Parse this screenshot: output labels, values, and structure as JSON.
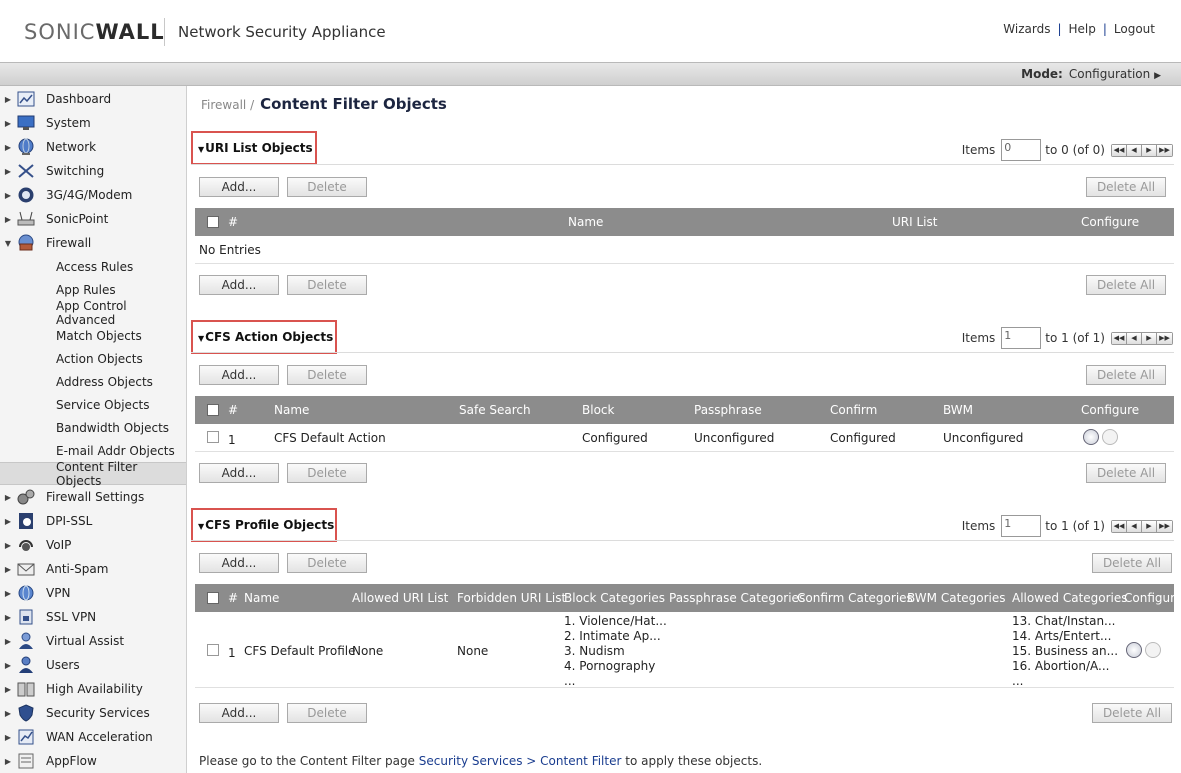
{
  "header": {
    "logo_light": "SONIC",
    "logo_bold": "WALL",
    "product": "Network Security Appliance",
    "links": [
      "Wizards",
      "Help",
      "Logout"
    ]
  },
  "modebar": {
    "label": "Mode:",
    "value": "Configuration"
  },
  "sidebar": {
    "items": [
      {
        "label": "Dashboard",
        "icon": "dashboard-icon",
        "expanded": false
      },
      {
        "label": "System",
        "icon": "monitor-icon",
        "expanded": false
      },
      {
        "label": "Network",
        "icon": "globe-icon",
        "expanded": false
      },
      {
        "label": "Switching",
        "icon": "switch-icon",
        "expanded": false
      },
      {
        "label": "3G/4G/Modem",
        "icon": "modem-icon",
        "expanded": false
      },
      {
        "label": "SonicPoint",
        "icon": "access-point-icon",
        "expanded": false
      },
      {
        "label": "Firewall",
        "icon": "firewall-icon",
        "expanded": true
      }
    ],
    "firewall_sub": [
      "Access Rules",
      "App Rules",
      "App Control Advanced",
      "Match Objects",
      "Action Objects",
      "Address Objects",
      "Service Objects",
      "Bandwidth Objects",
      "E-mail Addr Objects",
      "Content Filter Objects"
    ],
    "items_after": [
      {
        "label": "Firewall Settings",
        "icon": "gears-icon"
      },
      {
        "label": "DPI-SSL",
        "icon": "lock-icon"
      },
      {
        "label": "VoIP",
        "icon": "headset-icon"
      },
      {
        "label": "Anti-Spam",
        "icon": "mail-icon"
      },
      {
        "label": "VPN",
        "icon": "vpn-globe-icon"
      },
      {
        "label": "SSL VPN",
        "icon": "ssl-vpn-icon"
      },
      {
        "label": "Virtual Assist",
        "icon": "person-icon"
      },
      {
        "label": "Users",
        "icon": "users-icon"
      },
      {
        "label": "High Availability",
        "icon": "servers-icon"
      },
      {
        "label": "Security Services",
        "icon": "shield-icon"
      },
      {
        "label": "WAN Acceleration",
        "icon": "wan-icon"
      },
      {
        "label": "AppFlow",
        "icon": "appflow-icon"
      }
    ]
  },
  "breadcrumb": {
    "parent": "Firewall /",
    "current": "Content Filter Objects"
  },
  "uri": {
    "title": "URI List Objects",
    "items_label": "Items",
    "page_value": "0",
    "range": "to 0 (of 0)",
    "add": "Add...",
    "delete": "Delete",
    "delete_all": "Delete All",
    "cols": [
      "#",
      "Name",
      "URI List",
      "Configure"
    ],
    "empty": "No Entries"
  },
  "action": {
    "title": "CFS Action Objects",
    "items_label": "Items",
    "page_value": "1",
    "range": "to 1 (of 1)",
    "add": "Add...",
    "delete": "Delete",
    "delete_all": "Delete All",
    "cols": [
      "#",
      "Name",
      "Safe Search",
      "Block",
      "Passphrase",
      "Confirm",
      "BWM",
      "Configure"
    ],
    "row": {
      "num": "1",
      "name": "CFS Default Action",
      "block": "Configured",
      "passphrase": "Unconfigured",
      "confirm": "Configured",
      "bwm": "Unconfigured"
    }
  },
  "profile": {
    "title": "CFS Profile Objects",
    "items_label": "Items",
    "page_value": "1",
    "range": "to 1 (of 1)",
    "add": "Add...",
    "delete": "Delete",
    "delete_all": "Delete All",
    "cols": [
      "#",
      "Name",
      "Allowed URI List",
      "Forbidden URI List",
      "Block Categories",
      "Passphrase Categories",
      "Confirm Categories",
      "BWM Categories",
      "Allowed Categories",
      "Configure"
    ],
    "row": {
      "num": "1",
      "name": "CFS Default Profile",
      "allowed_uri": "None",
      "forbidden_uri": "None",
      "block_categories": [
        "1. Violence/Hat...",
        "2. Intimate Ap...",
        "3. Nudism",
        "4. Pornography",
        "..."
      ],
      "allowed_categories": [
        "13. Chat/Instan...",
        "14. Arts/Entert...",
        "15. Business an...",
        "16. Abortion/A...",
        "..."
      ]
    }
  },
  "footer": {
    "prefix": "Please go to the Content Filter page",
    "link": "Security Services > Content Filter",
    "suffix": "to apply these objects."
  }
}
